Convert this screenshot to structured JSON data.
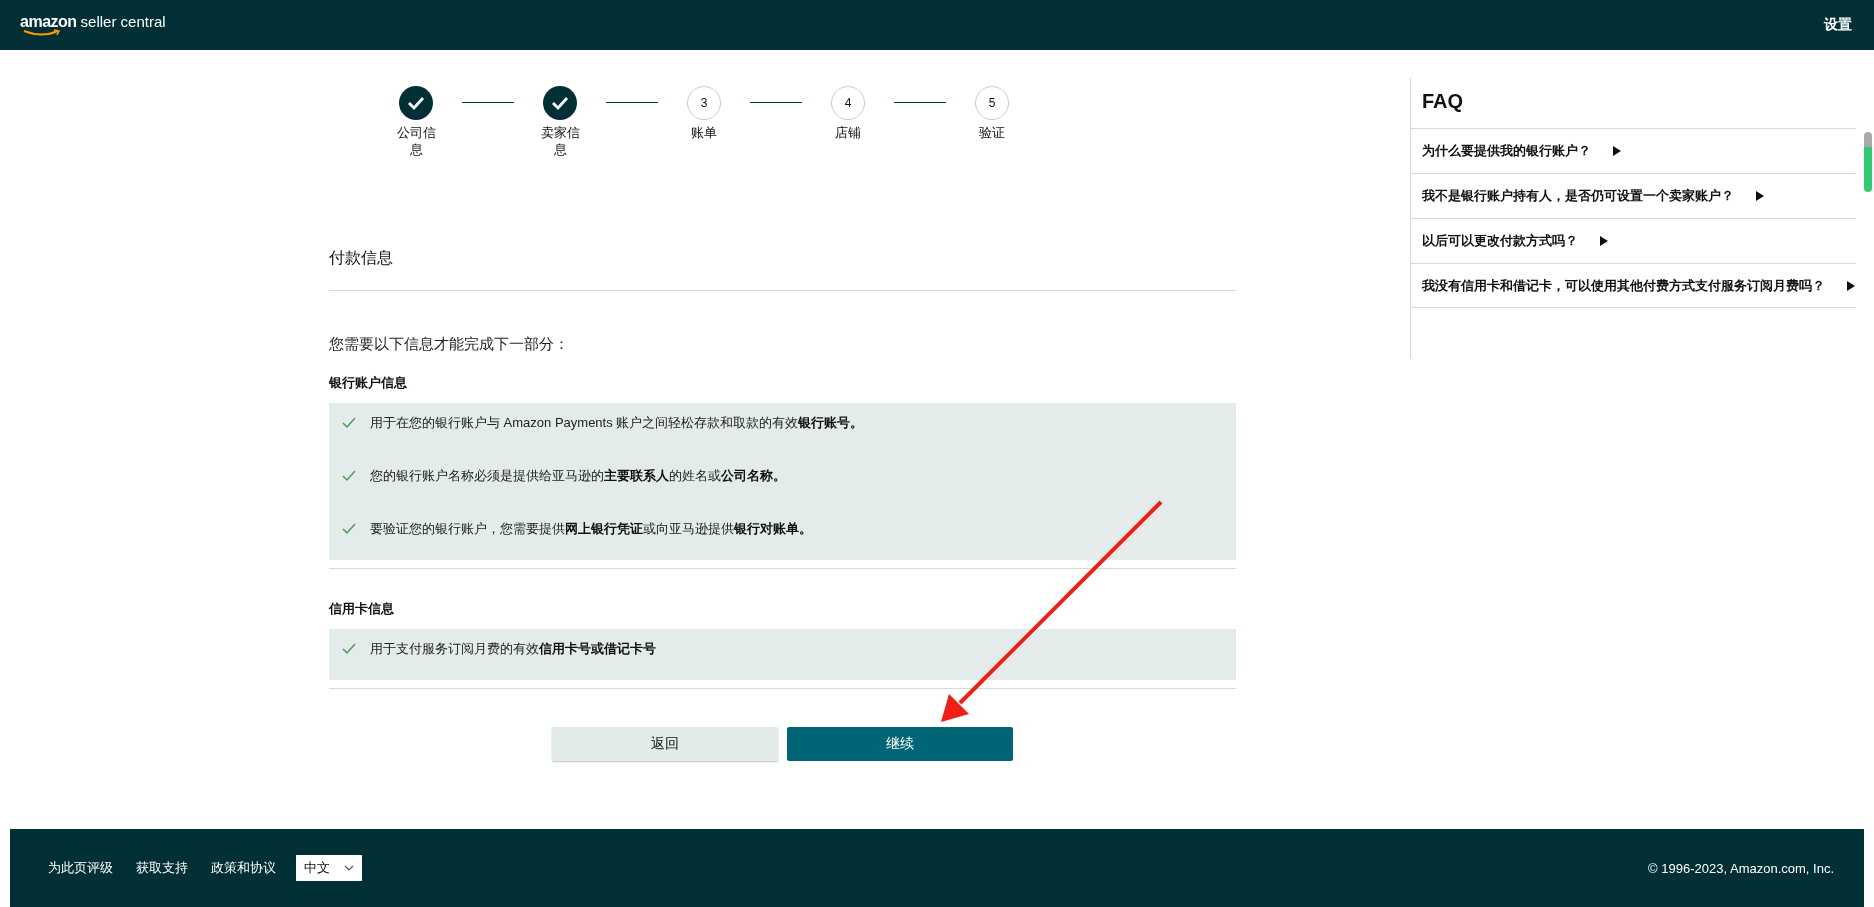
{
  "header": {
    "logo_text": "amazon",
    "logo_suffix": "seller central",
    "settings_link": "设置"
  },
  "steps": [
    {
      "label": "公司信息",
      "completed": true
    },
    {
      "label": "卖家信息",
      "completed": true
    },
    {
      "label": "账单",
      "completed": false,
      "number": "3"
    },
    {
      "label": "店铺",
      "completed": false,
      "number": "4"
    },
    {
      "label": "验证",
      "completed": false,
      "number": "5"
    }
  ],
  "section_title": "付款信息",
  "intro": "您需要以下信息才能完成下一部分：",
  "groups": [
    {
      "title": "银行账户信息",
      "items": [
        "用于在您的银行账户与 Amazon Payments 账户之间轻松存款和取款的有效**银行账号。**",
        "您的银行账户名称必须是提供给亚马逊的**主要联系人**的姓名或**公司名称。**",
        "要验证您的银行账户，您需要提供**网上银行凭证**或向亚马逊提供**银行对账单。**"
      ]
    },
    {
      "title": "信用卡信息",
      "items": [
        "用于支付服务订阅月费的有效**信用卡号或借记卡号**"
      ]
    }
  ],
  "buttons": [
    {
      "label": "返回",
      "kind": "secondary"
    },
    {
      "label": "继续",
      "kind": "primary"
    }
  ],
  "faq": {
    "title": "FAQ",
    "items": [
      "为什么要提供我的银行账户？",
      "我不是银行账户持有人，是否仍可设置一个卖家账户？",
      "以后可以更改付款方式吗？",
      "我没有信用卡和借记卡，可以使用其他付费方式支付服务订阅月费吗？"
    ]
  },
  "footer": {
    "links": [
      "为此页评级",
      "获取支持",
      "政策和协议"
    ],
    "language": "中文",
    "copyright": "© 1996-2023, Amazon.com, Inc."
  }
}
